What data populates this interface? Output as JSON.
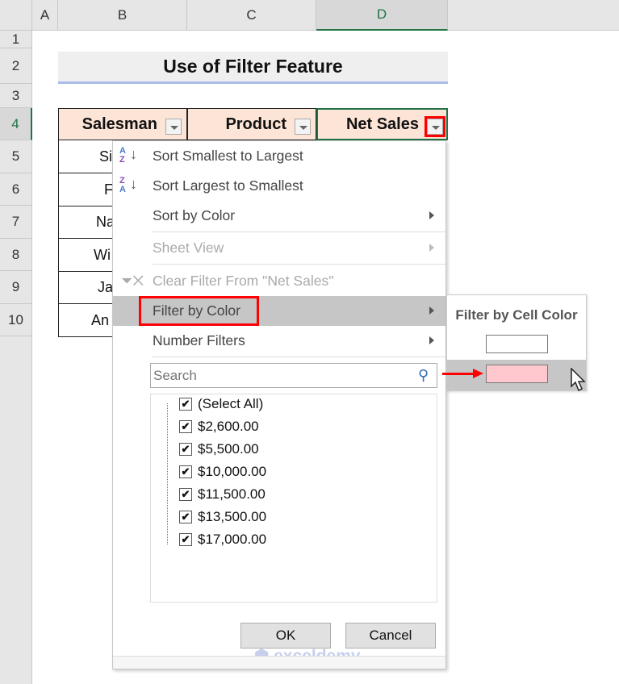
{
  "columns": [
    "A",
    "B",
    "C",
    "D"
  ],
  "rows": [
    "1",
    "2",
    "3",
    "4",
    "5",
    "6",
    "7",
    "8",
    "9",
    "10"
  ],
  "title": "Use of Filter Feature",
  "headers": [
    "Salesman",
    "Product",
    "Net Sales"
  ],
  "salesman_partial": [
    "Si",
    "F",
    "Na",
    "Wi",
    "Ja",
    "An"
  ],
  "menu": {
    "items": [
      {
        "label": "Sort Smallest to Largest",
        "icon": "sort-ascending-icon",
        "enabled": true
      },
      {
        "label": "Sort Largest to Smallest",
        "icon": "sort-descending-icon",
        "enabled": true
      },
      {
        "label": "Sort by Color",
        "submenu": true,
        "enabled": true
      },
      {
        "label": "Sheet View",
        "submenu": true,
        "enabled": false
      },
      {
        "label": "Clear Filter From \"Net Sales\"",
        "icon": "clear-filter-icon",
        "enabled": false
      },
      {
        "label": "Filter by Color",
        "submenu": true,
        "highlighted": true,
        "enabled": true
      },
      {
        "label": "Number Filters",
        "submenu": true,
        "enabled": true
      }
    ],
    "search_placeholder": "Search",
    "checklist": [
      "(Select All)",
      "$2,600.00",
      "$5,500.00",
      "$10,000.00",
      "$11,500.00",
      "$13,500.00",
      "$17,000.00"
    ],
    "ok": "OK",
    "cancel": "Cancel"
  },
  "submenu": {
    "title": "Filter by Cell Color",
    "colors": [
      "#ffffff",
      "#ffc7ce"
    ]
  },
  "colors": {
    "header_fill": "#fce4d6",
    "highlight_outline": "#ff0000",
    "selection": "#217346"
  },
  "watermark": "exceldemy"
}
